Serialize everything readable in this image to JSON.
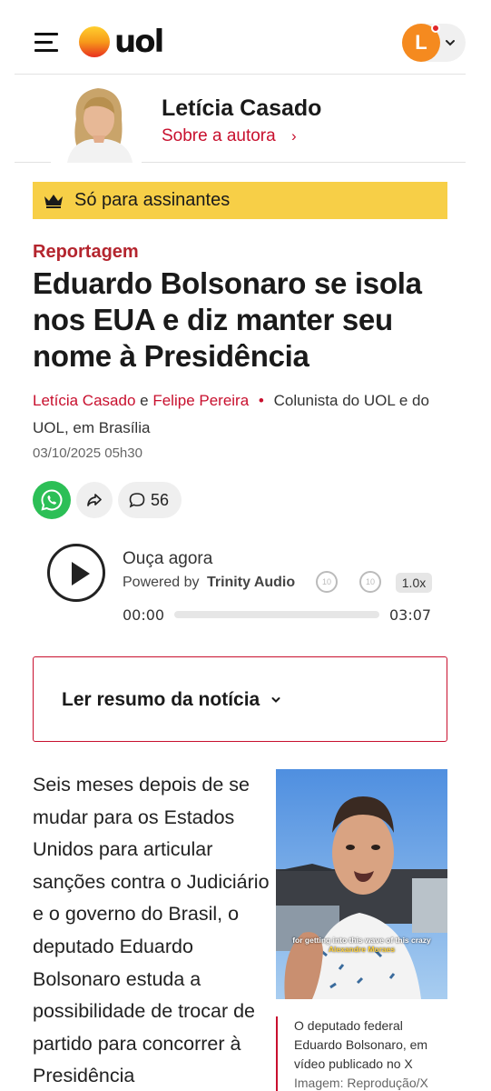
{
  "header": {
    "logo_text": "uol",
    "user_initial": "L"
  },
  "author": {
    "name": "Letícia Casado",
    "link_label": "Sobre a autora",
    "link_chevron": "›"
  },
  "badge": {
    "label": "Só para assinantes",
    "icon": "crown-icon",
    "color": "#f7cf47"
  },
  "article": {
    "kicker": "Reportagem",
    "headline": "Eduardo Bolsonaro se isola nos EUA e diz manter seu nome à Presidência",
    "byline": {
      "author1": "Letícia Casado",
      "conj": "e",
      "author2": "Felipe Pereira",
      "separator": "•",
      "role": "Colunista do UOL e do UOL, em Brasília"
    },
    "date": "03/10/2025 05h30",
    "comments_count": "56"
  },
  "audio": {
    "title": "Ouça agora",
    "powered_prefix": "Powered by",
    "powered_brand": "Trinity Audio",
    "rewind_label": "10",
    "forward_label": "10",
    "speed": "1.0x",
    "time_current": "00:00",
    "time_total": "03:07",
    "progress": 0
  },
  "summary": {
    "label": "Ler resumo da notícia",
    "chevron": "⌄"
  },
  "body": {
    "paragraph": "Seis meses depois de se mudar para os Estados Unidos para articular sanções contra o Judiciário e o governo do Brasil, o deputado Eduardo Bolsonaro estuda a possibilidade de trocar de partido para concorrer à Presidência"
  },
  "photo": {
    "subtitle_line1": "for getting into this wave of this crazy",
    "subtitle_line2": "Alexandre Moraes",
    "caption": "O deputado federal Eduardo Bolsonaro, em vídeo publicado no X",
    "credit": "Imagem: Reprodução/X"
  },
  "colors": {
    "brand_red": "#c8102e",
    "whatsapp_green": "#2cbf56",
    "avatar_orange": "#f58a1f"
  }
}
